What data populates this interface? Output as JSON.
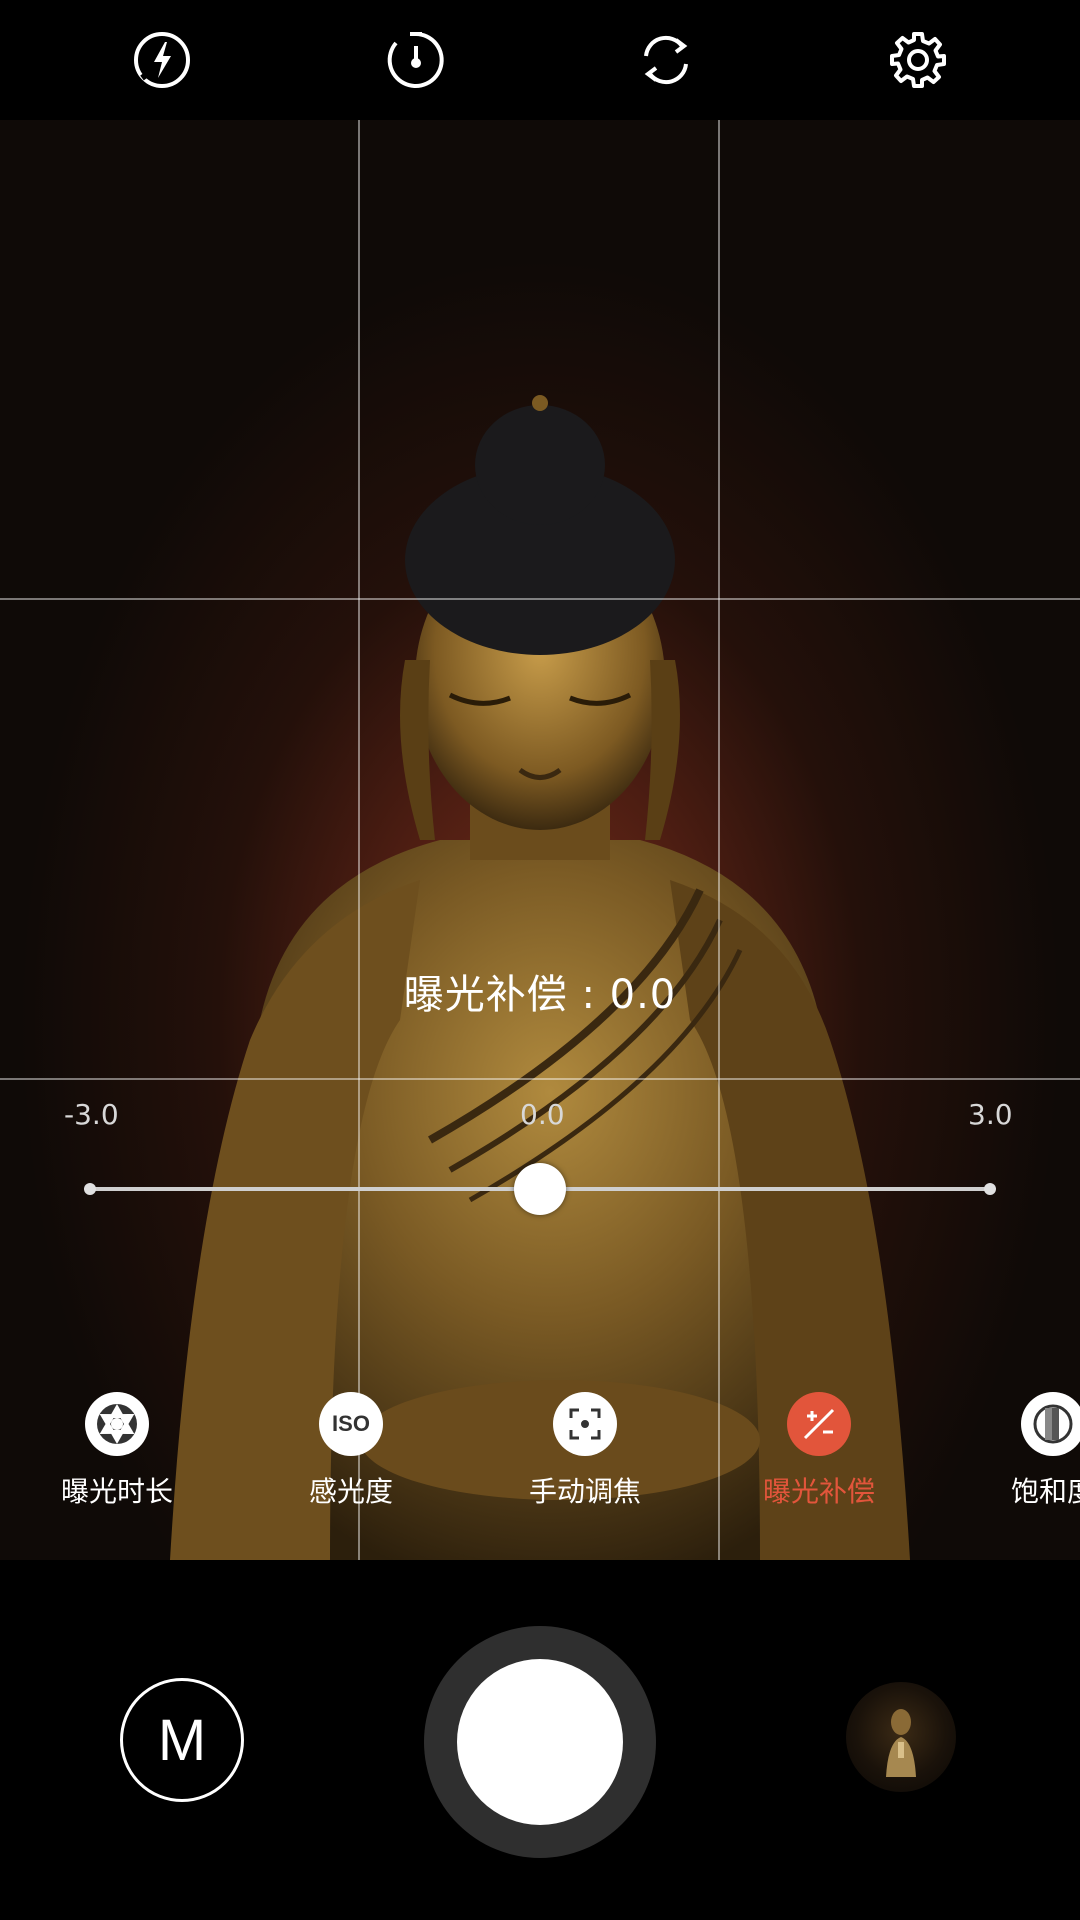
{
  "top_bar": {
    "icons": [
      "flash-auto-icon",
      "timer-icon",
      "switch-camera-icon",
      "settings-gear-icon"
    ]
  },
  "exposure": {
    "readout": "曝光补偿 : 0.0",
    "min_label": "-3.0",
    "mid_label": "0.0",
    "max_label": "3.0",
    "current_value": 0.0,
    "range": [
      -3.0,
      3.0
    ]
  },
  "modes": [
    {
      "label": "曝光时长",
      "icon": "aperture-icon",
      "active": false
    },
    {
      "label": "感光度",
      "icon": "iso-icon",
      "icon_text": "ISO",
      "active": false
    },
    {
      "label": "手动调焦",
      "icon": "focus-icon",
      "active": false
    },
    {
      "label": "曝光补偿",
      "icon": "exposure-compensation-icon",
      "active": true
    },
    {
      "label": "饱和度",
      "icon": "saturation-icon",
      "active": false
    }
  ],
  "bottom_bar": {
    "mode_button": "M"
  },
  "colors": {
    "accent": "#e2553b",
    "background": "#000000"
  }
}
